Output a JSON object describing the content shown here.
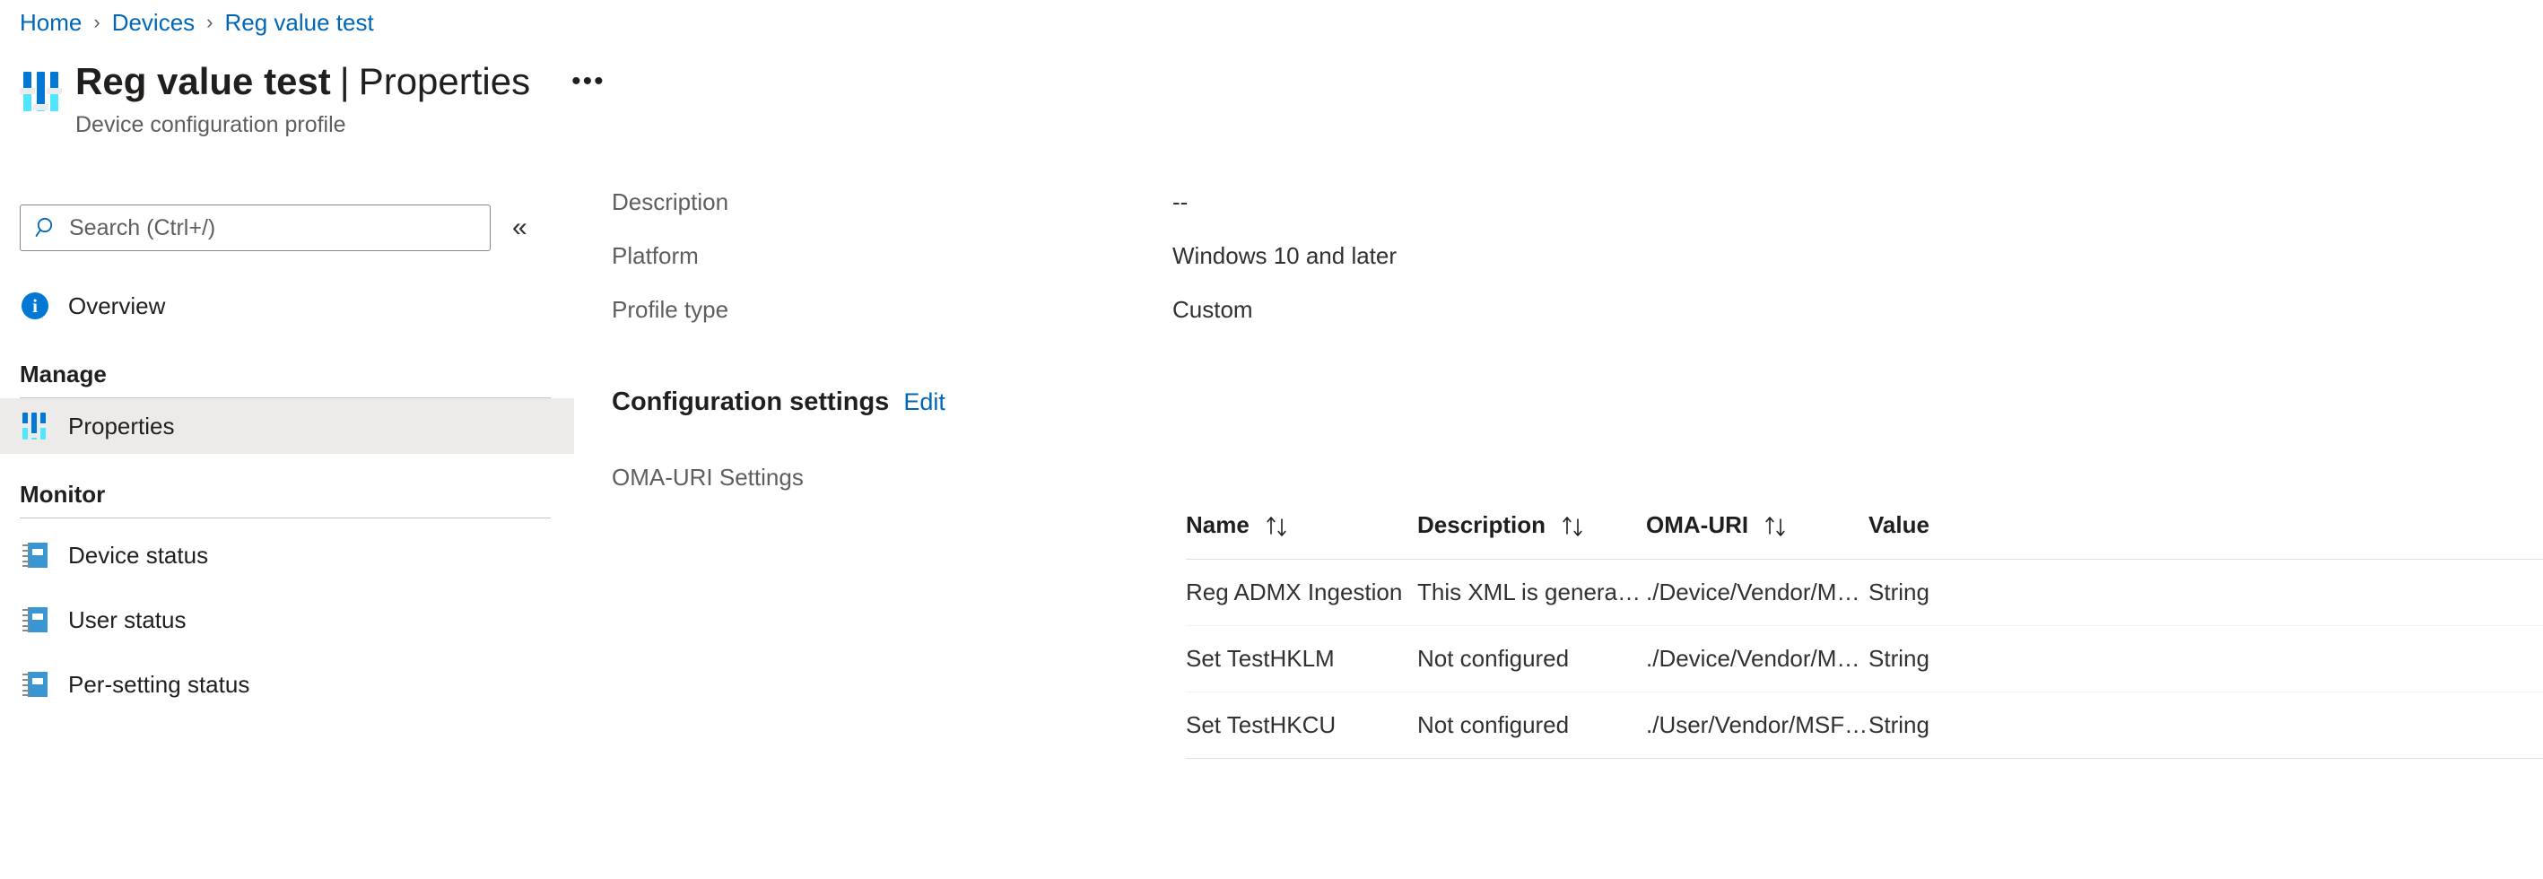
{
  "breadcrumb": {
    "items": [
      {
        "label": "Home"
      },
      {
        "label": "Devices"
      },
      {
        "label": "Reg value test"
      }
    ],
    "separator": "›"
  },
  "header": {
    "icon": "sliders-icon",
    "title_main": "Reg value test",
    "title_separator": "|",
    "title_section": "Properties",
    "more_menu": "•••",
    "subtitle": "Device configuration profile"
  },
  "sidebar": {
    "search": {
      "placeholder": "Search (Ctrl+/)",
      "value": "",
      "icon": "search-icon"
    },
    "collapse": {
      "label": "«",
      "icon": "chevron-double-left-icon"
    },
    "overview": {
      "label": "Overview",
      "icon": "info-icon"
    },
    "groups": [
      {
        "title": "Manage",
        "items": [
          {
            "label": "Properties",
            "icon": "sliders-icon",
            "selected": true
          }
        ]
      },
      {
        "title": "Monitor",
        "items": [
          {
            "label": "Device status",
            "icon": "report-icon",
            "selected": false
          },
          {
            "label": "User status",
            "icon": "report-icon",
            "selected": false
          },
          {
            "label": "Per-setting status",
            "icon": "report-icon",
            "selected": false
          }
        ]
      }
    ]
  },
  "main": {
    "properties": [
      {
        "label": "Description",
        "value": "--"
      },
      {
        "label": "Platform",
        "value": "Windows 10 and later"
      },
      {
        "label": "Profile type",
        "value": "Custom"
      }
    ],
    "configuration_settings": {
      "title": "Configuration settings",
      "edit_label": "Edit"
    },
    "oma_uri_label": "OMA-URI Settings"
  },
  "table": {
    "sort_icon": "sort-arrows-icon",
    "columns": [
      {
        "key": "name",
        "label": "Name",
        "sortable": true
      },
      {
        "key": "description",
        "label": "Description",
        "sortable": true
      },
      {
        "key": "omauri",
        "label": "OMA-URI",
        "sortable": true
      },
      {
        "key": "value",
        "label": "Value",
        "sortable": false
      }
    ],
    "rows": [
      {
        "name": "Reg ADMX Ingestion",
        "description": "This XML is generated by Int…",
        "omauri": "./Device/Vendor/MSFT/Polic…",
        "value": "String"
      },
      {
        "name": "Set TestHKLM",
        "description": "Not configured",
        "omauri": "./Device/Vendor/MSFT/Polic…",
        "value": "String"
      },
      {
        "name": "Set TestHKCU",
        "description": "Not configured",
        "omauri": "./User/Vendor/MSFT/Policy/…",
        "value": "String"
      }
    ]
  },
  "colors": {
    "link": "#0067b8",
    "accent": "#0078d4",
    "accent_light": "#50e6ff",
    "selected_bg": "#edebe9",
    "report_blue": "#3a96d2",
    "text": "#323130",
    "muted": "#605e5c"
  }
}
